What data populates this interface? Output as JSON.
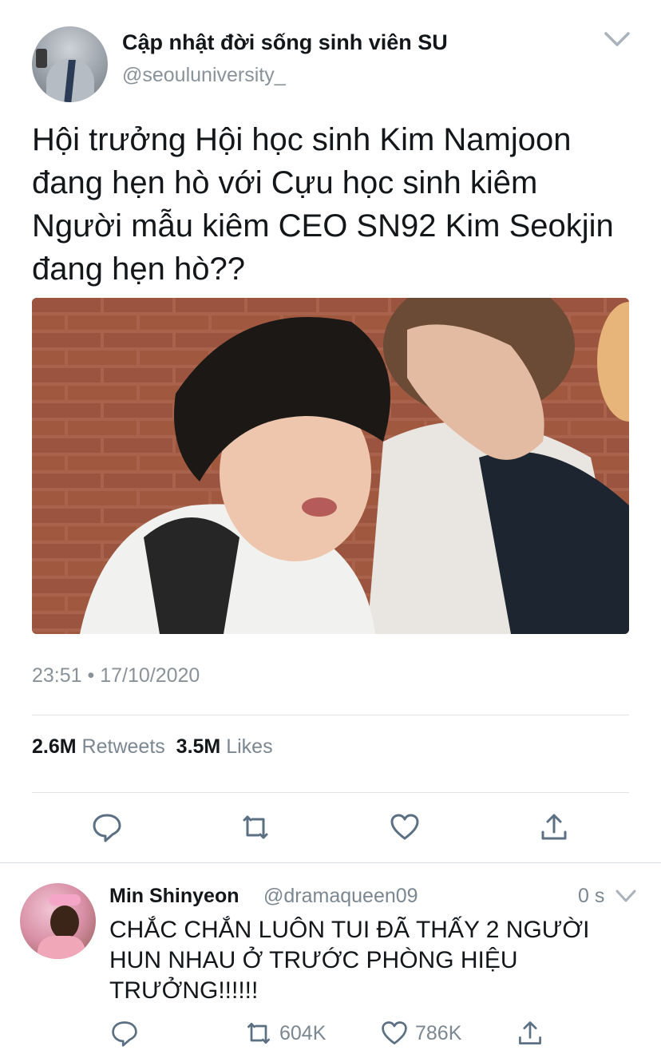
{
  "tweet": {
    "display_name": "Cập nhật đời sống sinh viên SU",
    "handle": "@seouluniversity_",
    "text": "Hội trưởng Hội học sinh Kim Namjoon\nđang hẹn hò với Cựu học sinh kiêm\nNgười mẫu kiêm CEO SN92 Kim Seokjin\nđang hẹn hò??",
    "timestamp": "23:51 • 17/10/2020",
    "retweets_count": "2.6M",
    "retweets_label": "Retweets",
    "likes_count": "3.5M",
    "likes_label": "Likes"
  },
  "actions": {
    "reply_icon": "reply-bubble-icon",
    "retweet_icon": "retweet-icon",
    "like_icon": "heart-icon",
    "share_icon": "share-upload-icon"
  },
  "reply": {
    "display_name": "Min Shinyeon",
    "handle": "@dramaqueen09",
    "time": "0 s",
    "text": "CHẮC CHẮN LUÔN TUI ĐÃ THẤY 2 NGƯỜI HUN NHAU Ở TRƯỚC PHÒNG HIỆU TRƯỞNG!!!!!!",
    "retweets": "604K",
    "likes": "786K"
  },
  "colors": {
    "text": "#14171a",
    "secondary": "#8a9299",
    "divider": "#e1e5e8",
    "icon": "#5b7083"
  }
}
